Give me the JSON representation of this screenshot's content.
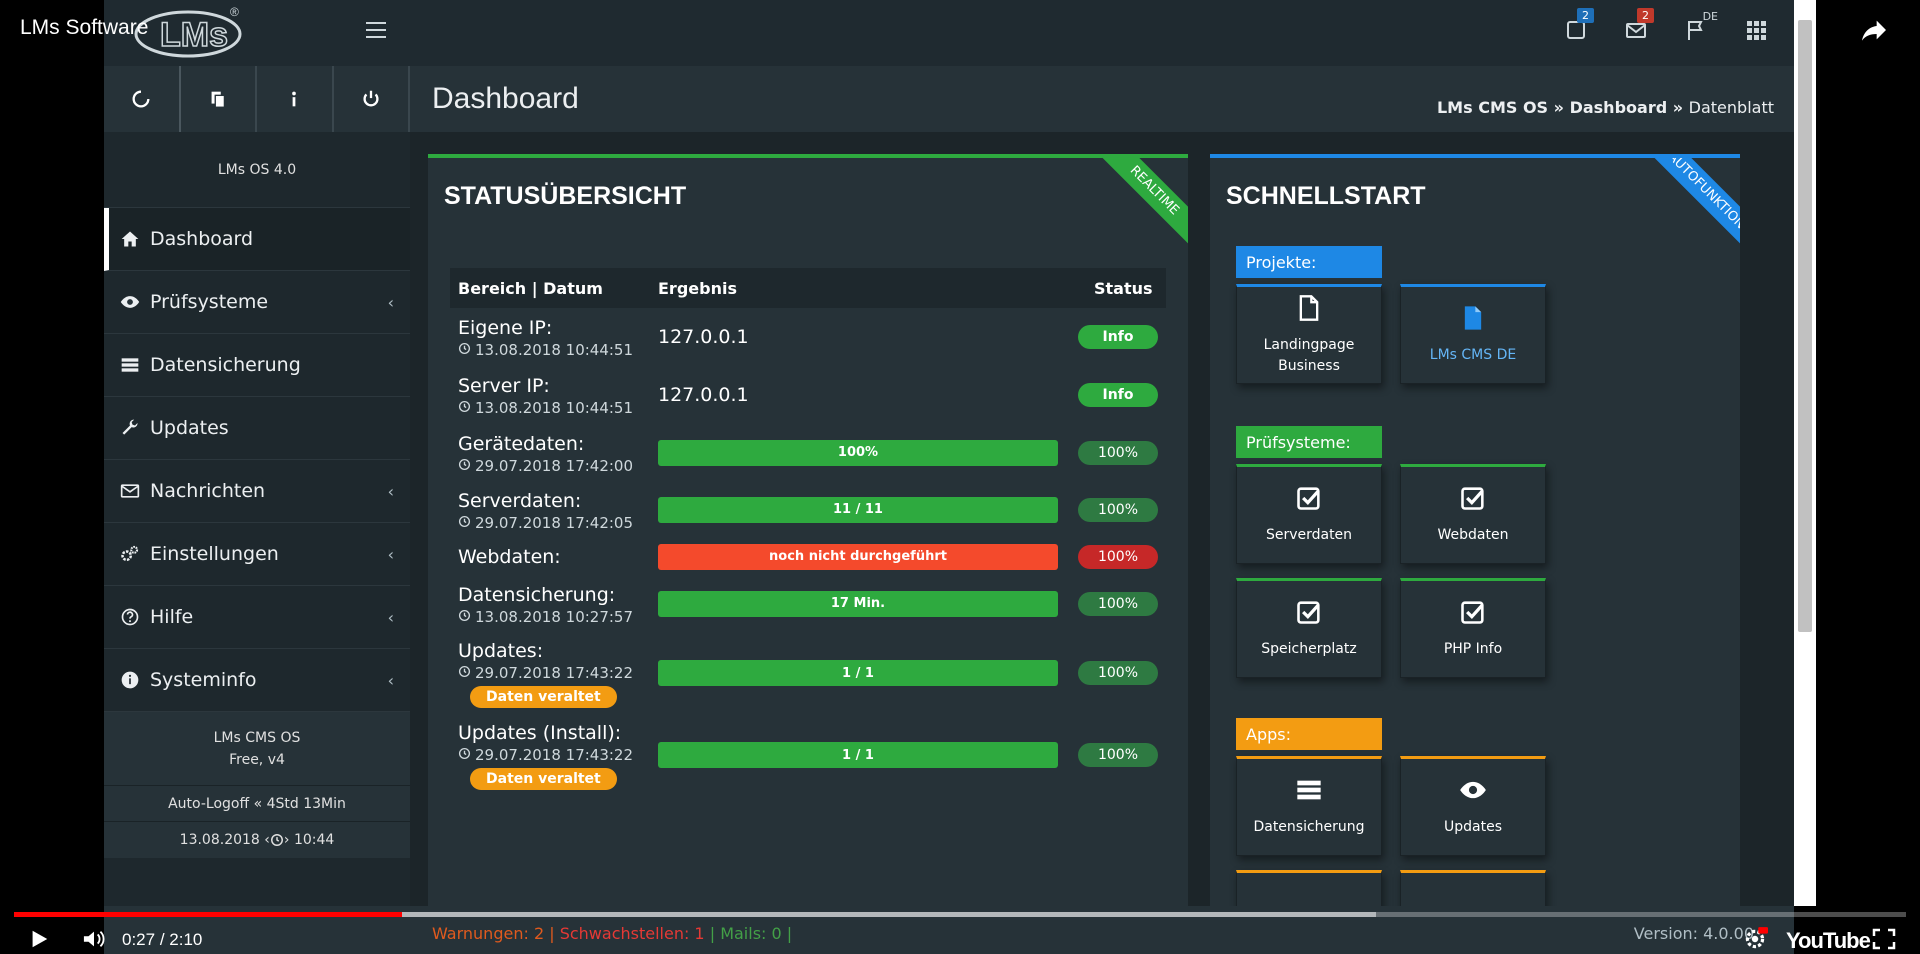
{
  "video": {
    "title": "LMs Software",
    "time_current": "0:27",
    "time_total": "2:10",
    "time_sep": " / ",
    "played_fraction": 0.205,
    "buffered_fraction": 0.72,
    "brand": "YouTube"
  },
  "topbar": {
    "logo_text": "LMs",
    "badge_tasks": "2",
    "badge_mail": "2",
    "lang": "DE"
  },
  "sidebar": {
    "version": "LMs OS 4.0",
    "items": [
      {
        "label": "Dashboard",
        "icon": "home-icon"
      },
      {
        "label": "Prüfsysteme",
        "icon": "eye-icon",
        "chevron": "‹"
      },
      {
        "label": "Datensicherung",
        "icon": "server-icon"
      },
      {
        "label": "Updates",
        "icon": "wrench-icon"
      },
      {
        "label": "Nachrichten",
        "icon": "envelope-icon",
        "chevron": "‹"
      },
      {
        "label": "Einstellungen",
        "icon": "gears-icon",
        "chevron": "‹"
      },
      {
        "label": "Hilfe",
        "icon": "question-icon",
        "chevron": "‹"
      },
      {
        "label": "Systeminfo",
        "icon": "info-icon",
        "chevron": "‹"
      }
    ],
    "footer_product": "LMs CMS OS",
    "footer_edition": "Free, v4",
    "autologoff_label": "Auto-Logoff",
    "autologoff_sep": "«",
    "autologoff_value": "4Std 13Min",
    "date": "13.08.2018",
    "time": "10:44"
  },
  "header": {
    "title": "Dashboard",
    "breadcrumb": [
      "LMs CMS OS",
      "Dashboard",
      "Datenblatt"
    ],
    "breadcrumb_sep": "»"
  },
  "status": {
    "title": "STATUSÜBERSICHT",
    "ribbon": "REALTIME",
    "columns": [
      "Bereich | Datum",
      "Ergebnis",
      "Status"
    ],
    "rows": [
      {
        "name": "Eigene IP:",
        "date": "13.08.2018 10:44:51",
        "result": "127.0.0.1",
        "status": "Info"
      },
      {
        "name": "Server IP:",
        "date": "13.08.2018 10:44:51",
        "result": "127.0.0.1",
        "status": "Info"
      },
      {
        "name": "Gerätedaten:",
        "date": "29.07.2018 17:42:00",
        "result": "100%",
        "status": "100%"
      },
      {
        "name": "Serverdaten:",
        "date": "29.07.2018 17:42:05",
        "result": "11 / 11",
        "status": "100%"
      },
      {
        "name": "Webdaten:",
        "date": "",
        "result": "noch nicht durchgeführt",
        "status": "100%"
      },
      {
        "name": "Datensicherung:",
        "date": "13.08.2018 10:27:57",
        "result": "17 Min.",
        "status": "100%"
      },
      {
        "name": "Updates:",
        "date": "29.07.2018 17:43:22",
        "result": "1 / 1",
        "status": "100%",
        "warning": "Daten veraltet"
      },
      {
        "name": "Updates (Install):",
        "date": "29.07.2018 17:43:22",
        "result": "1 / 1",
        "status": "100%",
        "warning": "Daten veraltet"
      }
    ]
  },
  "quickstart": {
    "title": "SCHNELLSTART",
    "ribbon": "AUTOFUNKTION",
    "groups": [
      {
        "label": "Projekte:",
        "color": "#1e88e5",
        "tiles": [
          {
            "label": "Landingpage Business",
            "icon": "file-outline-icon"
          },
          {
            "label": "LMs CMS DE",
            "icon": "file-blue-icon"
          }
        ]
      },
      {
        "label": "Prüfsysteme:",
        "color": "#2eaa3f",
        "tiles": [
          {
            "label": "Serverdaten",
            "icon": "check-square-icon"
          },
          {
            "label": "Webdaten",
            "icon": "check-square-icon"
          },
          {
            "label": "Speicherplatz",
            "icon": "check-square-icon"
          },
          {
            "label": "PHP Info",
            "icon": "check-square-icon"
          }
        ]
      },
      {
        "label": "Apps:",
        "color": "#f39c12",
        "tiles": [
          {
            "label": "Datensicherung",
            "icon": "server-icon"
          },
          {
            "label": "Updates",
            "icon": "eye-icon"
          }
        ]
      }
    ]
  },
  "statusbar": {
    "warnings": "Warnungen: 2",
    "weak": "Schwachstellen: 1",
    "mails": "Mails: 0",
    "sep": "|",
    "version": "Version: 4.0.00"
  },
  "colors": {
    "green": "#2eaa3f",
    "red": "#f44a2c",
    "blue": "#1e88e5",
    "orange": "#f39c12",
    "panel": "#263238",
    "sidebar": "#1e282d"
  }
}
